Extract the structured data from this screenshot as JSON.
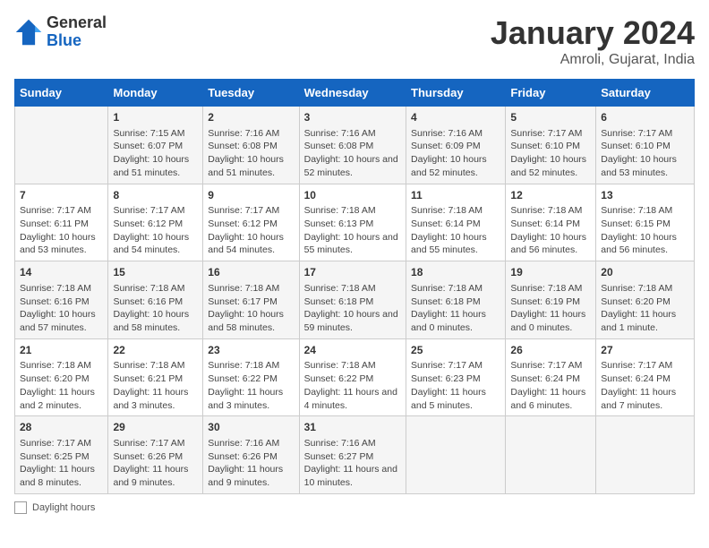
{
  "header": {
    "logo_general": "General",
    "logo_blue": "Blue",
    "title": "January 2024",
    "subtitle": "Amroli, Gujarat, India"
  },
  "days_of_week": [
    "Sunday",
    "Monday",
    "Tuesday",
    "Wednesday",
    "Thursday",
    "Friday",
    "Saturday"
  ],
  "footer": {
    "label": "Daylight hours"
  },
  "weeks": [
    [
      {
        "day": "",
        "sunrise": "",
        "sunset": "",
        "daylight": ""
      },
      {
        "day": "1",
        "sunrise": "Sunrise: 7:15 AM",
        "sunset": "Sunset: 6:07 PM",
        "daylight": "Daylight: 10 hours and 51 minutes."
      },
      {
        "day": "2",
        "sunrise": "Sunrise: 7:16 AM",
        "sunset": "Sunset: 6:08 PM",
        "daylight": "Daylight: 10 hours and 51 minutes."
      },
      {
        "day": "3",
        "sunrise": "Sunrise: 7:16 AM",
        "sunset": "Sunset: 6:08 PM",
        "daylight": "Daylight: 10 hours and 52 minutes."
      },
      {
        "day": "4",
        "sunrise": "Sunrise: 7:16 AM",
        "sunset": "Sunset: 6:09 PM",
        "daylight": "Daylight: 10 hours and 52 minutes."
      },
      {
        "day": "5",
        "sunrise": "Sunrise: 7:17 AM",
        "sunset": "Sunset: 6:10 PM",
        "daylight": "Daylight: 10 hours and 52 minutes."
      },
      {
        "day": "6",
        "sunrise": "Sunrise: 7:17 AM",
        "sunset": "Sunset: 6:10 PM",
        "daylight": "Daylight: 10 hours and 53 minutes."
      }
    ],
    [
      {
        "day": "7",
        "sunrise": "Sunrise: 7:17 AM",
        "sunset": "Sunset: 6:11 PM",
        "daylight": "Daylight: 10 hours and 53 minutes."
      },
      {
        "day": "8",
        "sunrise": "Sunrise: 7:17 AM",
        "sunset": "Sunset: 6:12 PM",
        "daylight": "Daylight: 10 hours and 54 minutes."
      },
      {
        "day": "9",
        "sunrise": "Sunrise: 7:17 AM",
        "sunset": "Sunset: 6:12 PM",
        "daylight": "Daylight: 10 hours and 54 minutes."
      },
      {
        "day": "10",
        "sunrise": "Sunrise: 7:18 AM",
        "sunset": "Sunset: 6:13 PM",
        "daylight": "Daylight: 10 hours and 55 minutes."
      },
      {
        "day": "11",
        "sunrise": "Sunrise: 7:18 AM",
        "sunset": "Sunset: 6:14 PM",
        "daylight": "Daylight: 10 hours and 55 minutes."
      },
      {
        "day": "12",
        "sunrise": "Sunrise: 7:18 AM",
        "sunset": "Sunset: 6:14 PM",
        "daylight": "Daylight: 10 hours and 56 minutes."
      },
      {
        "day": "13",
        "sunrise": "Sunrise: 7:18 AM",
        "sunset": "Sunset: 6:15 PM",
        "daylight": "Daylight: 10 hours and 56 minutes."
      }
    ],
    [
      {
        "day": "14",
        "sunrise": "Sunrise: 7:18 AM",
        "sunset": "Sunset: 6:16 PM",
        "daylight": "Daylight: 10 hours and 57 minutes."
      },
      {
        "day": "15",
        "sunrise": "Sunrise: 7:18 AM",
        "sunset": "Sunset: 6:16 PM",
        "daylight": "Daylight: 10 hours and 58 minutes."
      },
      {
        "day": "16",
        "sunrise": "Sunrise: 7:18 AM",
        "sunset": "Sunset: 6:17 PM",
        "daylight": "Daylight: 10 hours and 58 minutes."
      },
      {
        "day": "17",
        "sunrise": "Sunrise: 7:18 AM",
        "sunset": "Sunset: 6:18 PM",
        "daylight": "Daylight: 10 hours and 59 minutes."
      },
      {
        "day": "18",
        "sunrise": "Sunrise: 7:18 AM",
        "sunset": "Sunset: 6:18 PM",
        "daylight": "Daylight: 11 hours and 0 minutes."
      },
      {
        "day": "19",
        "sunrise": "Sunrise: 7:18 AM",
        "sunset": "Sunset: 6:19 PM",
        "daylight": "Daylight: 11 hours and 0 minutes."
      },
      {
        "day": "20",
        "sunrise": "Sunrise: 7:18 AM",
        "sunset": "Sunset: 6:20 PM",
        "daylight": "Daylight: 11 hours and 1 minute."
      }
    ],
    [
      {
        "day": "21",
        "sunrise": "Sunrise: 7:18 AM",
        "sunset": "Sunset: 6:20 PM",
        "daylight": "Daylight: 11 hours and 2 minutes."
      },
      {
        "day": "22",
        "sunrise": "Sunrise: 7:18 AM",
        "sunset": "Sunset: 6:21 PM",
        "daylight": "Daylight: 11 hours and 3 minutes."
      },
      {
        "day": "23",
        "sunrise": "Sunrise: 7:18 AM",
        "sunset": "Sunset: 6:22 PM",
        "daylight": "Daylight: 11 hours and 3 minutes."
      },
      {
        "day": "24",
        "sunrise": "Sunrise: 7:18 AM",
        "sunset": "Sunset: 6:22 PM",
        "daylight": "Daylight: 11 hours and 4 minutes."
      },
      {
        "day": "25",
        "sunrise": "Sunrise: 7:17 AM",
        "sunset": "Sunset: 6:23 PM",
        "daylight": "Daylight: 11 hours and 5 minutes."
      },
      {
        "day": "26",
        "sunrise": "Sunrise: 7:17 AM",
        "sunset": "Sunset: 6:24 PM",
        "daylight": "Daylight: 11 hours and 6 minutes."
      },
      {
        "day": "27",
        "sunrise": "Sunrise: 7:17 AM",
        "sunset": "Sunset: 6:24 PM",
        "daylight": "Daylight: 11 hours and 7 minutes."
      }
    ],
    [
      {
        "day": "28",
        "sunrise": "Sunrise: 7:17 AM",
        "sunset": "Sunset: 6:25 PM",
        "daylight": "Daylight: 11 hours and 8 minutes."
      },
      {
        "day": "29",
        "sunrise": "Sunrise: 7:17 AM",
        "sunset": "Sunset: 6:26 PM",
        "daylight": "Daylight: 11 hours and 9 minutes."
      },
      {
        "day": "30",
        "sunrise": "Sunrise: 7:16 AM",
        "sunset": "Sunset: 6:26 PM",
        "daylight": "Daylight: 11 hours and 9 minutes."
      },
      {
        "day": "31",
        "sunrise": "Sunrise: 7:16 AM",
        "sunset": "Sunset: 6:27 PM",
        "daylight": "Daylight: 11 hours and 10 minutes."
      },
      {
        "day": "",
        "sunrise": "",
        "sunset": "",
        "daylight": ""
      },
      {
        "day": "",
        "sunrise": "",
        "sunset": "",
        "daylight": ""
      },
      {
        "day": "",
        "sunrise": "",
        "sunset": "",
        "daylight": ""
      }
    ]
  ]
}
